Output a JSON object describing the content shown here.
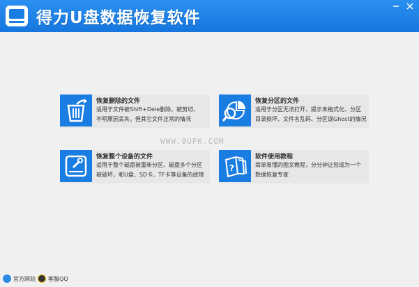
{
  "app": {
    "title": "得力U盘数据恢复软件"
  },
  "cards": [
    {
      "title": "恢复删除的文件",
      "line1": "适用于文件被Shift+Dele删除、被剪切、",
      "line2": "不明原因丢失，但其它文件正常的情况",
      "icon": "trash-restore-icon"
    },
    {
      "title": "恢复分区的文件",
      "line1": "适用于分区无法打开、提示未格式化、分区",
      "line2": "目录损坏、文件名乱码、分区误Ghost的情况",
      "icon": "partition-search-icon"
    },
    {
      "title": "恢复整个设备的文件",
      "line1": "适用于整个磁盘被重新分区、磁盘多个分区",
      "line2": "被破坏，和U盘、SD卡、TF卡等设备的故障",
      "icon": "disk-repair-icon"
    },
    {
      "title": "软件使用教程",
      "line1": "简单易懂的图文教程，分分钟让您成为一个",
      "line2": "数据恢复专家",
      "icon": "tutorial-icon"
    }
  ],
  "watermark": "WWW.9UPK.COM",
  "footer": {
    "website": "官方网站",
    "qq": "客服QQ"
  },
  "colors": {
    "accent": "#1a7de2",
    "titlebar": "#2a90f0",
    "card_bg": "#e7e7e7"
  }
}
